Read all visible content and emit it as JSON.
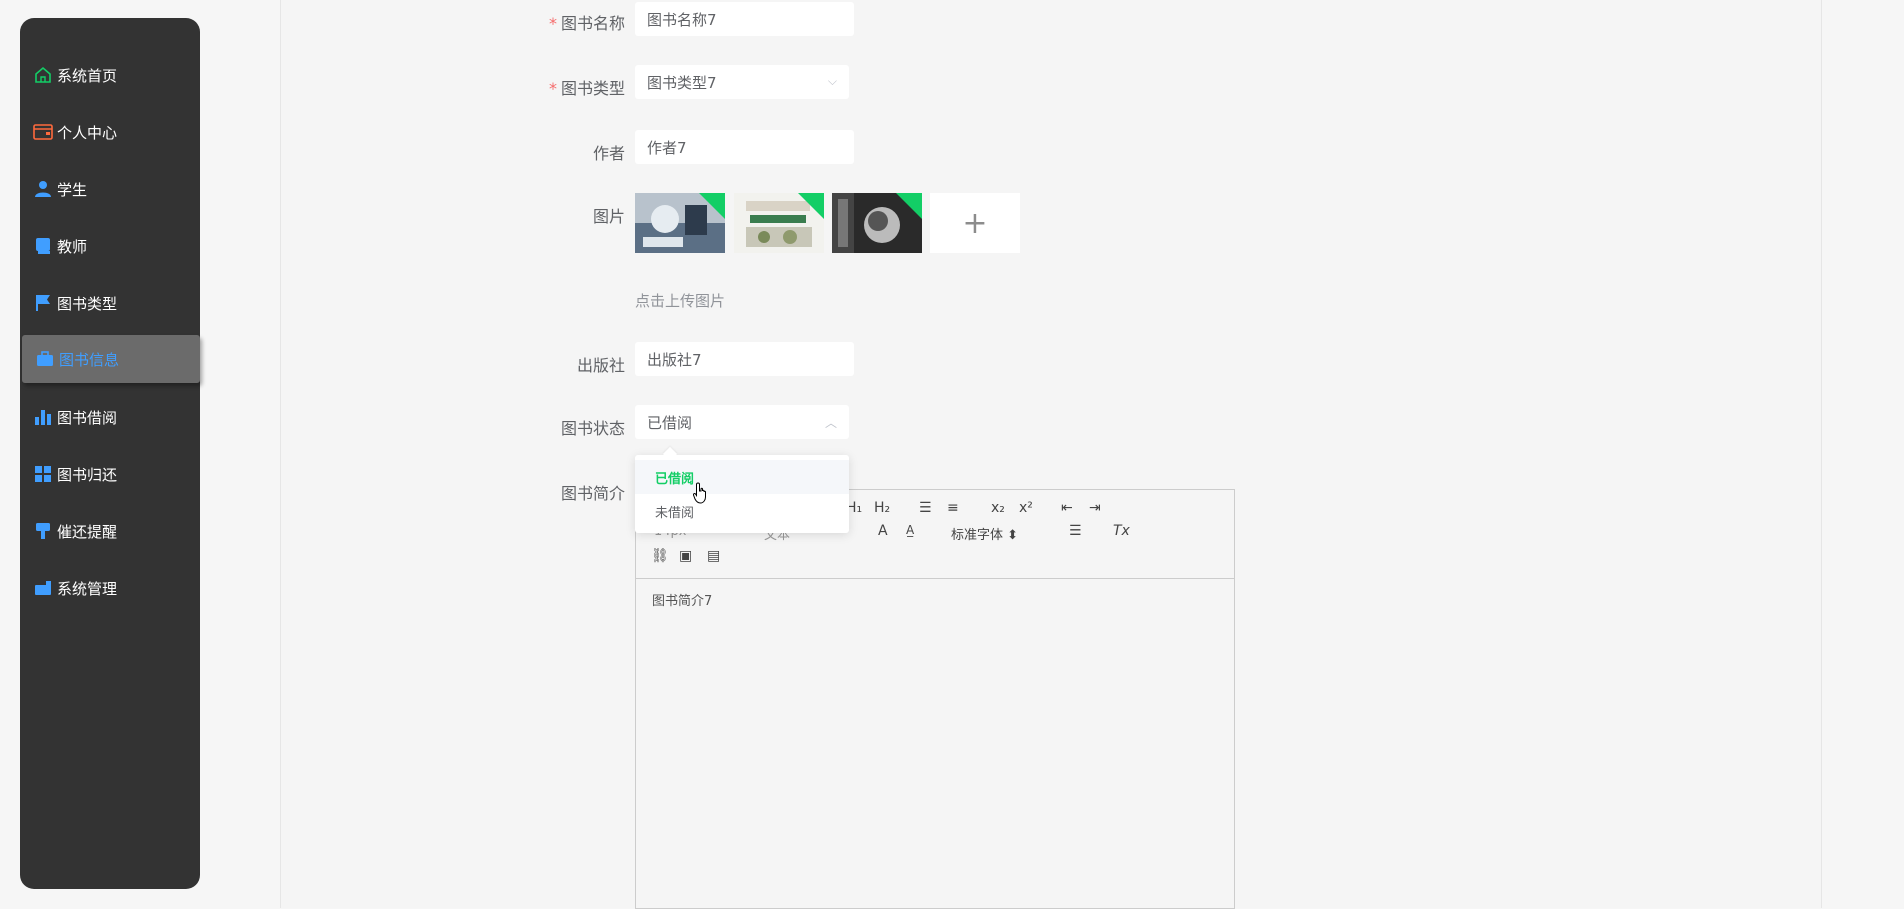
{
  "sidebar": {
    "items": [
      {
        "label": "系统首页",
        "icon": "home-icon",
        "color": "#13ce66"
      },
      {
        "label": "个人中心",
        "icon": "wallet-icon",
        "color": "#ff6a3d"
      },
      {
        "label": "学生",
        "icon": "user-icon",
        "color": "#409eff"
      },
      {
        "label": "教师",
        "icon": "book-icon",
        "color": "#409eff"
      },
      {
        "label": "图书类型",
        "icon": "flag-icon",
        "color": "#409eff"
      },
      {
        "label": "图书信息",
        "icon": "briefcase-icon",
        "color": "#409eff",
        "active": true
      },
      {
        "label": "图书借阅",
        "icon": "bar-chart-icon",
        "color": "#409eff"
      },
      {
        "label": "图书归还",
        "icon": "grid-icon",
        "color": "#409eff"
      },
      {
        "label": "催还提醒",
        "icon": "brush-icon",
        "color": "#409eff"
      },
      {
        "label": "系统管理",
        "icon": "toolbox-icon",
        "color": "#409eff"
      }
    ]
  },
  "form": {
    "name_label": "图书名称",
    "name_value": "图书名称7",
    "type_label": "图书类型",
    "type_value": "图书类型7",
    "author_label": "作者",
    "author_value": "作者7",
    "image_label": "图片",
    "upload_hint": "点击上传图片",
    "upload_plus": "+",
    "publisher_label": "出版社",
    "publisher_value": "出版社7",
    "status_label": "图书状态",
    "status_value": "已借阅",
    "intro_label": "图书简介",
    "status_options": [
      "已借阅",
      "未借阅"
    ]
  },
  "editor": {
    "h1": "H₁",
    "h2": "H₂",
    "sub": "x₂",
    "sup": "x²",
    "size": "14px",
    "text_type": "文本",
    "font": "标准字体",
    "content": "图书简介7"
  }
}
